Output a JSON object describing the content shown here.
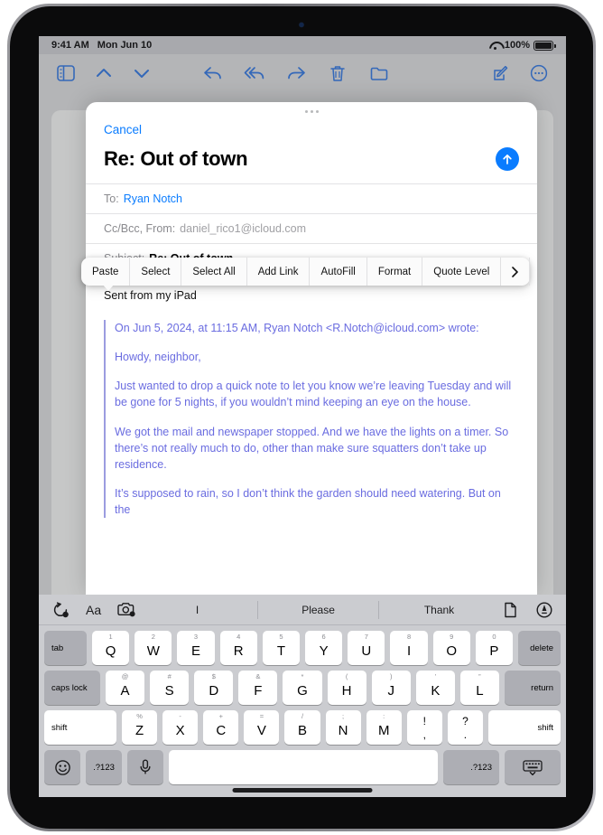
{
  "status_bar": {
    "time": "9:41 AM",
    "date": "Mon Jun 10",
    "battery": "100%"
  },
  "mail_toolbar": {
    "sidebar": "sidebar-icon",
    "up": "chevron-up-icon",
    "down": "chevron-down-icon",
    "reply": "reply-icon",
    "reply_all": "reply-all-icon",
    "forward": "forward-icon",
    "trash": "trash-icon",
    "folder": "folder-icon",
    "compose": "compose-icon",
    "more": "more-icon"
  },
  "compose": {
    "cancel_label": "Cancel",
    "title": "Re: Out of town",
    "send_icon": "send-arrow-up-icon",
    "fields": [
      {
        "label": "To:",
        "value": "Ryan Notch",
        "style": "link"
      },
      {
        "label": "Cc/Bcc, From:",
        "value": "daniel_rico1@icloud.com",
        "style": "gray"
      },
      {
        "label": "Subject:",
        "value": "Re: Out of town",
        "style": "bold"
      }
    ],
    "signature": "Sent from my iPad",
    "quoted": [
      "On Jun 5, 2024, at 11:15 AM, Ryan Notch <R.Notch@icloud.com> wrote:",
      "Howdy, neighbor,",
      "Just wanted to drop a quick note to let you know we’re leaving Tuesday and will be gone for 5 nights, if you wouldn’t mind keeping an eye on the house.",
      "We got the mail and newspaper stopped. And we have the lights on a timer. So there’s not really much to do, other than make sure squatters don’t take up residence.",
      "It’s supposed to rain, so I don’t think the garden should need watering. But on the"
    ]
  },
  "edit_menu": {
    "items": [
      "Paste",
      "Select",
      "Select All",
      "Add Link",
      "AutoFill",
      "Format",
      "Quote Level"
    ],
    "more_icon": "chevron-right-icon"
  },
  "keyboard": {
    "predictive": {
      "left_icons": [
        "undo-icon",
        "text-format-icon",
        "camera-icon"
      ],
      "suggestions": [
        "I",
        "Please",
        "Thank"
      ],
      "right_icons": [
        "document-icon",
        "markup-pen-icon"
      ]
    },
    "row1": [
      {
        "main": "tab",
        "type": "mod-left"
      },
      {
        "main": "Q",
        "sub": "1"
      },
      {
        "main": "W",
        "sub": "2"
      },
      {
        "main": "E",
        "sub": "3"
      },
      {
        "main": "R",
        "sub": "4"
      },
      {
        "main": "T",
        "sub": "5"
      },
      {
        "main": "Y",
        "sub": "6"
      },
      {
        "main": "U",
        "sub": "7"
      },
      {
        "main": "I",
        "sub": "8"
      },
      {
        "main": "O",
        "sub": "9"
      },
      {
        "main": "P",
        "sub": "0"
      },
      {
        "main": "delete",
        "type": "mod-right"
      }
    ],
    "row2": [
      {
        "main": "caps lock",
        "type": "mod-left"
      },
      {
        "main": "A",
        "sub": "@"
      },
      {
        "main": "S",
        "sub": "#"
      },
      {
        "main": "D",
        "sub": "$"
      },
      {
        "main": "F",
        "sub": "&"
      },
      {
        "main": "G",
        "sub": "*"
      },
      {
        "main": "H",
        "sub": "("
      },
      {
        "main": "J",
        "sub": ")"
      },
      {
        "main": "K",
        "sub": "’"
      },
      {
        "main": "L",
        "sub": "”"
      },
      {
        "main": "return",
        "type": "mod-right"
      }
    ],
    "row3": [
      {
        "main": "shift",
        "type": "shift-left"
      },
      {
        "main": "Z",
        "sub": "%"
      },
      {
        "main": "X",
        "sub": "-"
      },
      {
        "main": "C",
        "sub": "+"
      },
      {
        "main": "V",
        "sub": "="
      },
      {
        "main": "B",
        "sub": "/"
      },
      {
        "main": "N",
        "sub": ";"
      },
      {
        "main": "M",
        "sub": ":"
      },
      {
        "main": ",",
        "sub": "!",
        "punct": true
      },
      {
        "main": ".",
        "sub": "?",
        "punct": true
      },
      {
        "main": "shift",
        "type": "shift-right"
      }
    ],
    "row4": {
      "emoji": "emoji-icon",
      "numeric_left": ".?123",
      "mic": "microphone-icon",
      "space": "",
      "numeric_right": ".?123",
      "dismiss": "hide-keyboard-icon"
    }
  }
}
